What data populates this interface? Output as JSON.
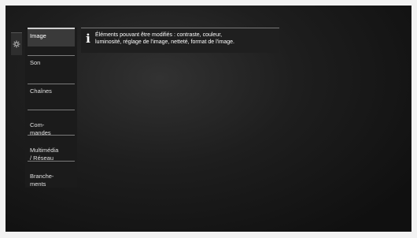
{
  "settings_tab": {
    "icon": "gear-icon"
  },
  "menu": {
    "items": [
      {
        "label": "Image",
        "active": true
      },
      {
        "label": "Son",
        "active": false
      },
      {
        "label": "Chaînes",
        "active": false
      },
      {
        "label": "Com-\nmandes",
        "active": false
      },
      {
        "label": "Multimédia\n/ Réseau",
        "active": false
      },
      {
        "label": "Branche-\nments",
        "active": false
      }
    ]
  },
  "info": {
    "icon": "info-icon",
    "icon_glyph": "i",
    "line1": "Éléments pouvant être modifiés : contraste, couleur,",
    "line2": "luminosité, réglage de l'image, netteté, format de l'image."
  }
}
